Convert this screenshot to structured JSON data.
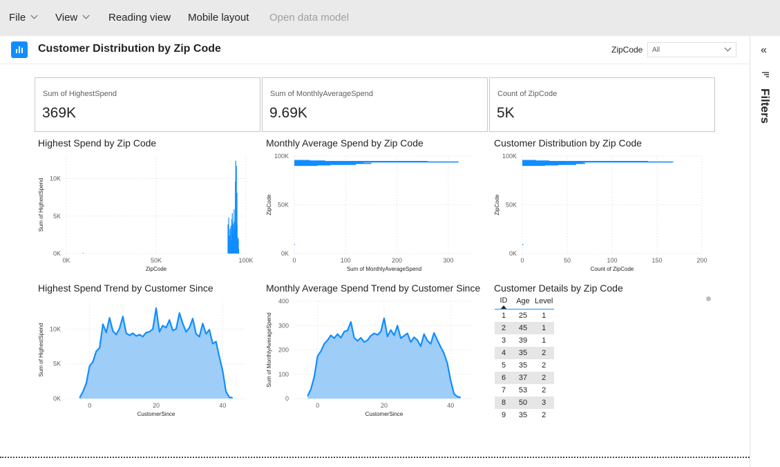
{
  "menu": {
    "file": "File",
    "view": "View",
    "reading_view": "Reading view",
    "mobile_layout": "Mobile layout",
    "open_data_model": "Open data model"
  },
  "page": {
    "title": "Customer Distribution by Zip Code",
    "zip_filter_label": "ZipCode",
    "zip_filter_value": "All"
  },
  "filters_pane": {
    "label": "Filters",
    "collapse_glyph": "«"
  },
  "cards": [
    {
      "label": "Sum of HighestSpend",
      "value": "369K"
    },
    {
      "label": "Sum of MonthlyAverageSpend",
      "value": "9.69K"
    },
    {
      "label": "Count of ZipCode",
      "value": "5K"
    }
  ],
  "visual_titles": {
    "highest_spend_zip": "Highest Spend by Zip Code",
    "monthly_avg_zip": "Monthly Average Spend by Zip Code",
    "customer_dist_zip": "Customer Distribution by Zip Code",
    "highest_trend": "Highest Spend Trend by Customer Since",
    "monthly_trend": "Monthly Average Spend Trend by Customer Since",
    "customer_details": "Customer Details by Zip Code"
  },
  "chart_data": [
    {
      "type": "bar",
      "title": "Highest Spend by Zip Code",
      "xlabel": "ZipCode",
      "ylabel": "Sum of HighestSpend",
      "x_ticks": [
        "0K",
        "50K",
        "100K"
      ],
      "y_ticks": [
        "0K",
        "5K",
        "10K"
      ],
      "xlim": [
        0,
        100000
      ],
      "ylim": [
        0,
        13000
      ],
      "grid": true,
      "x": [
        9300,
        90000,
        90400,
        90800,
        91100,
        91300,
        91600,
        91900,
        92100,
        92400,
        92600,
        92900,
        93100,
        93400,
        93600,
        93900,
        94100,
        94300,
        94500,
        94700,
        94900,
        95000,
        95100,
        95300,
        95500,
        95600,
        95800,
        96000
      ],
      "values": [
        80,
        3900,
        4800,
        2400,
        3300,
        2900,
        3700,
        1800,
        4600,
        5400,
        4200,
        2600,
        3900,
        5900,
        4300,
        3100,
        9600,
        12400,
        7000,
        11700,
        5200,
        8100,
        3800,
        2200,
        1600,
        1400,
        2000,
        600
      ]
    },
    {
      "type": "bar",
      "orientation": "horizontal",
      "title": "Monthly Average Spend by Zip Code",
      "xlabel": "Sum of MonthlyAverageSpend",
      "ylabel": "ZipCode",
      "x_ticks": [
        "0",
        "100",
        "200",
        "300"
      ],
      "y_ticks": [
        "0K",
        "50K",
        "100K"
      ],
      "xlim": [
        0,
        350
      ],
      "ylim": [
        0,
        100000
      ],
      "grid": true,
      "y": [
        9300,
        90500,
        91000,
        91500,
        92000,
        92500,
        93000,
        93500,
        94000,
        94500,
        95000,
        95500
      ],
      "values": [
        1,
        45,
        70,
        120,
        95,
        150,
        80,
        135,
        320,
        260,
        60,
        30
      ]
    },
    {
      "type": "bar",
      "orientation": "horizontal",
      "title": "Customer Distribution by Zip Code",
      "xlabel": "Count of ZipCode",
      "ylabel": "ZipCode",
      "x_ticks": [
        "0",
        "50",
        "100",
        "150",
        "200"
      ],
      "y_ticks": [
        "0K",
        "50K",
        "100K"
      ],
      "xlim": [
        0,
        200
      ],
      "ylim": [
        0,
        100000
      ],
      "grid": true,
      "y": [
        9300,
        90500,
        91000,
        91500,
        92000,
        92500,
        93000,
        93500,
        94000,
        94500,
        95000,
        95500
      ],
      "values": [
        1,
        25,
        40,
        60,
        50,
        70,
        45,
        68,
        168,
        140,
        30,
        15
      ]
    },
    {
      "type": "area",
      "title": "Highest Spend Trend by Customer Since",
      "xlabel": "CustomerSince",
      "ylabel": "Sum of HighestSpend",
      "x_ticks": [
        "0",
        "20",
        "40"
      ],
      "y_ticks": [
        "0K",
        "5K",
        "10K"
      ],
      "xlim": [
        -7,
        47
      ],
      "ylim": [
        0,
        14000
      ],
      "grid": true,
      "x": [
        -3,
        -2,
        -1,
        0,
        1,
        2,
        3,
        4,
        5,
        6,
        7,
        8,
        9,
        10,
        11,
        12,
        13,
        14,
        15,
        16,
        17,
        18,
        19,
        20,
        21,
        22,
        23,
        24,
        25,
        26,
        27,
        28,
        29,
        30,
        31,
        32,
        33,
        34,
        35,
        36,
        37,
        38,
        39,
        40,
        41,
        42,
        43
      ],
      "values": [
        100,
        1000,
        2200,
        4700,
        5300,
        6800,
        7300,
        10700,
        9500,
        11600,
        9700,
        9200,
        10100,
        11800,
        9400,
        9100,
        9400,
        9000,
        9200,
        8900,
        9500,
        9600,
        10000,
        13000,
        9600,
        10500,
        10200,
        11300,
        9800,
        10000,
        12300,
        10800,
        9600,
        10200,
        11500,
        9300,
        8900,
        10800,
        9300,
        9900,
        7900,
        8200,
        6000,
        4000,
        1000,
        200,
        100
      ]
    },
    {
      "type": "area",
      "title": "Monthly Average Spend Trend by Customer Since",
      "xlabel": "CustomerSince",
      "ylabel": "Sum of MonthlyAverageSpend",
      "x_ticks": [
        "0",
        "20",
        "40"
      ],
      "y_ticks": [
        "0",
        "100",
        "200",
        "300",
        "400"
      ],
      "xlim": [
        -7,
        47
      ],
      "ylim": [
        0,
        400
      ],
      "grid": true,
      "x": [
        -3,
        -2,
        -1,
        0,
        1,
        2,
        3,
        4,
        5,
        6,
        7,
        8,
        9,
        10,
        11,
        12,
        13,
        14,
        15,
        16,
        17,
        18,
        19,
        20,
        21,
        22,
        23,
        24,
        25,
        26,
        27,
        28,
        29,
        30,
        31,
        32,
        33,
        34,
        35,
        36,
        37,
        38,
        39,
        40,
        41,
        42,
        43
      ],
      "values": [
        10,
        40,
        90,
        175,
        195,
        225,
        240,
        260,
        248,
        265,
        250,
        275,
        280,
        315,
        250,
        237,
        250,
        232,
        240,
        258,
        268,
        262,
        275,
        330,
        255,
        282,
        260,
        300,
        248,
        258,
        268,
        232,
        252,
        240,
        215,
        265,
        238,
        225,
        270,
        240,
        212,
        186,
        145,
        75,
        20,
        8,
        5
      ]
    }
  ],
  "customer_table": {
    "columns": [
      "ID",
      "Age",
      "Level"
    ],
    "rows": [
      [
        "1",
        "25",
        "1"
      ],
      [
        "2",
        "45",
        "1"
      ],
      [
        "3",
        "39",
        "1"
      ],
      [
        "4",
        "35",
        "2"
      ],
      [
        "5",
        "35",
        "2"
      ],
      [
        "6",
        "37",
        "2"
      ],
      [
        "7",
        "53",
        "2"
      ],
      [
        "8",
        "50",
        "3"
      ],
      [
        "9",
        "35",
        "2"
      ]
    ]
  },
  "colors": {
    "accent": "#118dff",
    "area_fill": "#9ecdf8",
    "topbar_bg": "#eaeaea"
  }
}
